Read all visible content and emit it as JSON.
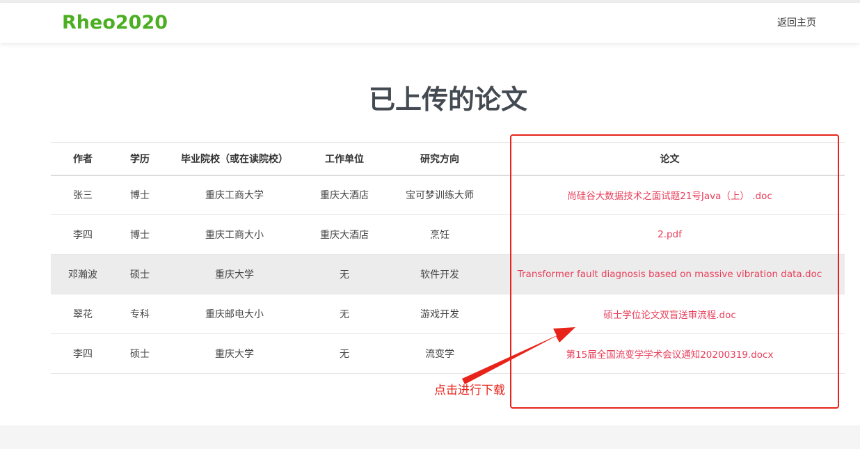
{
  "nav": {
    "brand": "Rheo2020",
    "home_link": "返回主页"
  },
  "page": {
    "title": "已上传的论文"
  },
  "table": {
    "headers": [
      "作者",
      "学历",
      "毕业院校（或在读院校）",
      "工作单位",
      "研究方向",
      "论文"
    ],
    "rows": [
      {
        "author": "张三",
        "degree": "博士",
        "school": "重庆工商大学",
        "org": "重庆大酒店",
        "field": "宝可梦训练大师",
        "paper": "尚硅谷大数据技术之面试题21号Java（上） .doc"
      },
      {
        "author": "李四",
        "degree": "博士",
        "school": "重庆工商大小",
        "org": "重庆大酒店",
        "field": "烹饪",
        "paper": "2.pdf"
      },
      {
        "author": "邓瀚波",
        "degree": "硕士",
        "school": "重庆大学",
        "org": "无",
        "field": "软件开发",
        "paper": "Transformer fault diagnosis based on massive vibration data.doc"
      },
      {
        "author": "翠花",
        "degree": "专科",
        "school": "重庆邮电大小",
        "org": "无",
        "field": "游戏开发",
        "paper": "硕士学位论文双盲送审流程.doc"
      },
      {
        "author": "李四",
        "degree": "硕士",
        "school": "重庆大学",
        "org": "无",
        "field": "流变学",
        "paper": "第15届全国流变学学术会议通知20200319.docx"
      }
    ]
  },
  "annotation": {
    "text": "点击进行下载",
    "color": "#e8231a"
  },
  "colors": {
    "brand": "#4caf22",
    "link": "#e83e5a"
  }
}
